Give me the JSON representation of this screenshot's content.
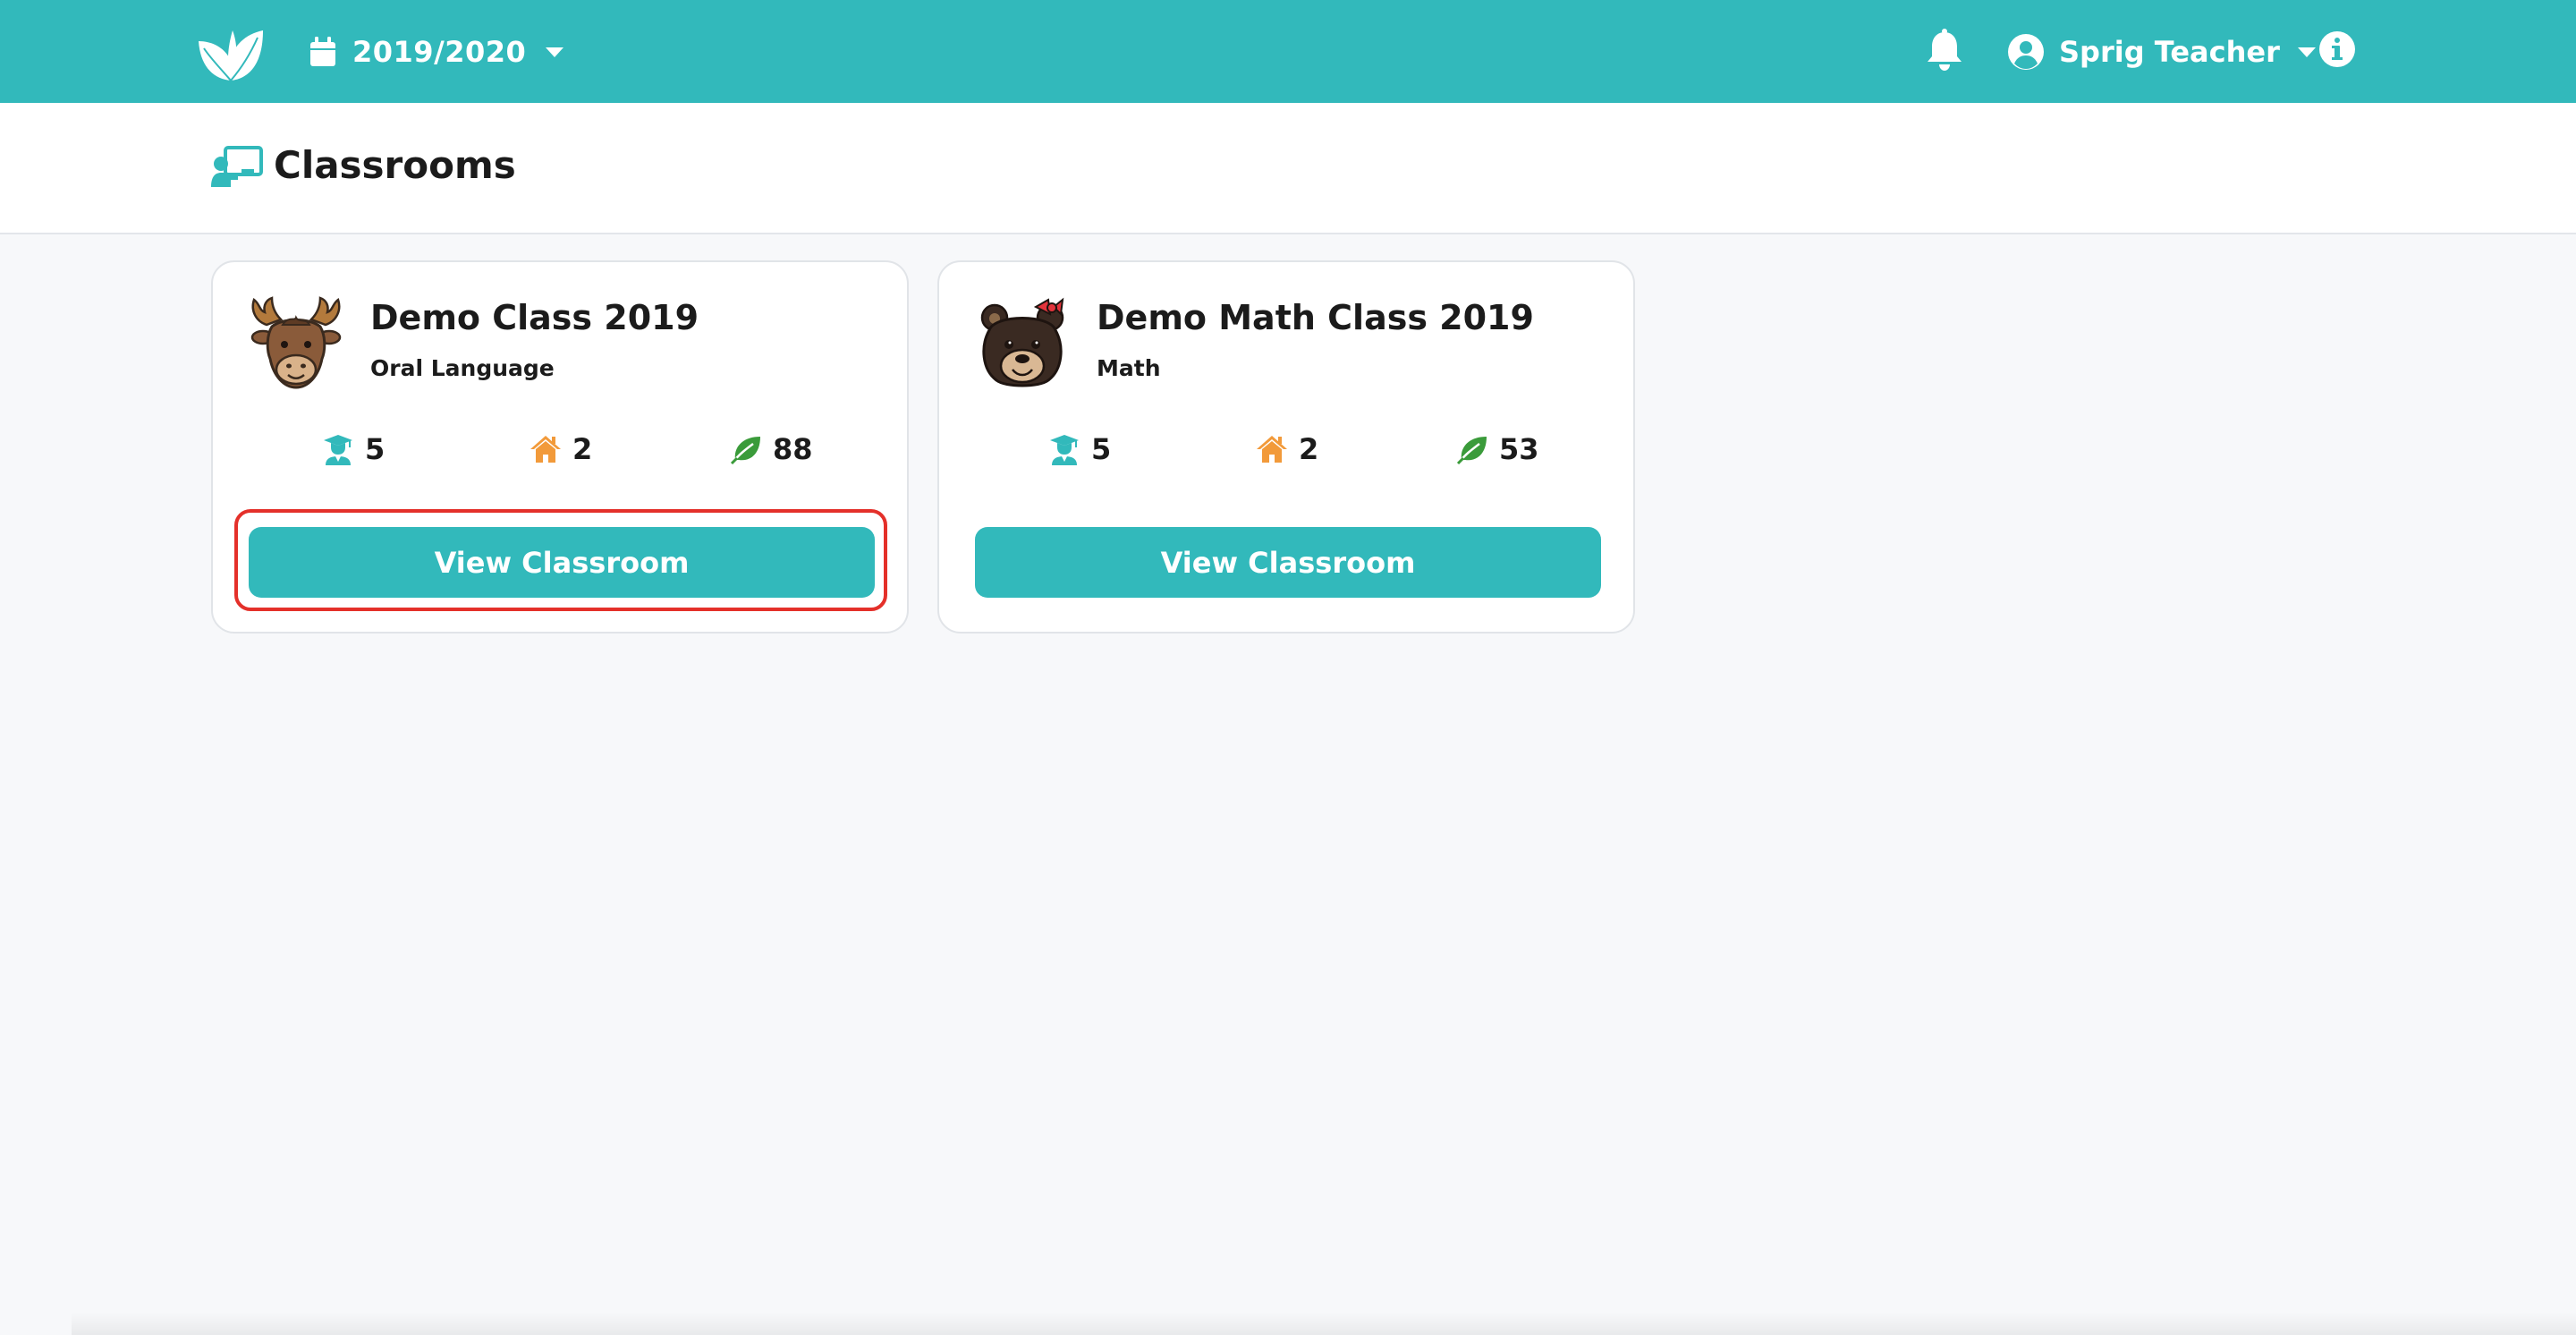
{
  "topbar": {
    "logo_icon": "leaf-logo-icon",
    "year": "2019/2020",
    "year_icon": "calendar-icon",
    "bell_icon": "bell-icon",
    "user_icon": "user-circle-icon",
    "user_name": "Sprig Teacher",
    "info_icon": "info-icon",
    "background_color": "#32b9bb"
  },
  "page": {
    "title": "Classrooms",
    "title_icon": "chalkboard-teacher-icon"
  },
  "classrooms": [
    {
      "name": "Demo Class 2019",
      "subject": "Oral Language",
      "avatar_icon": "moose-avatar-icon",
      "students": "5",
      "homes": "2",
      "leaves": "88",
      "button_label": "View Classroom",
      "highlighted": true
    },
    {
      "name": "Demo Math Class 2019",
      "subject": "Math",
      "avatar_icon": "bear-avatar-icon",
      "students": "5",
      "homes": "2",
      "leaves": "53",
      "button_label": "View Classroom",
      "highlighted": false
    }
  ],
  "colors": {
    "accent": "#32b9bb",
    "student_icon": "#32b9bb",
    "home_icon": "#f29a3a",
    "leaf_icon": "#3a9b3a",
    "highlight": "#e4302a"
  }
}
